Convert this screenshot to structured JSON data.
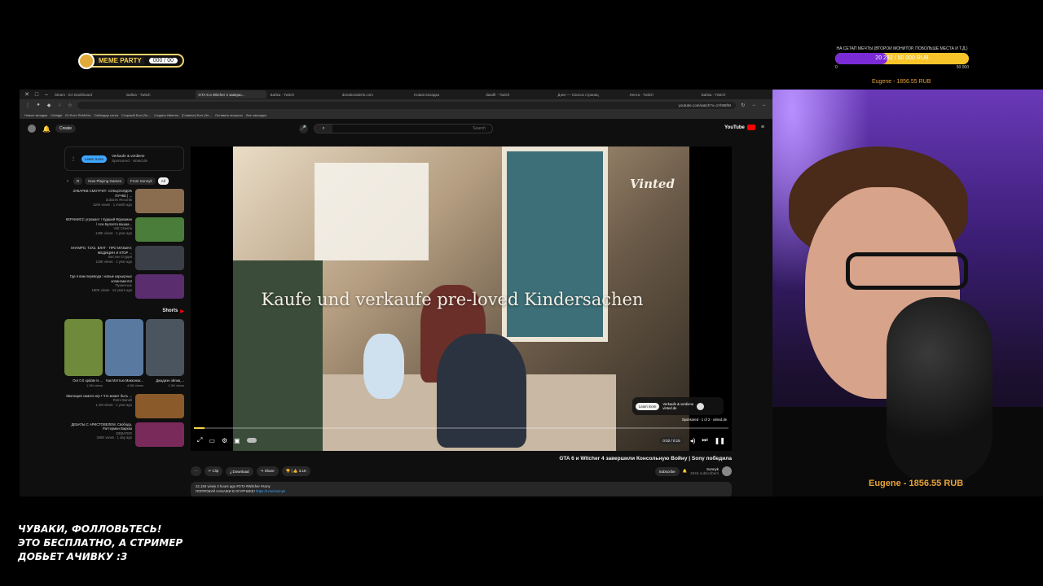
{
  "overlays": {
    "meme_badge": {
      "title": "MEME PARTY",
      "value": "000 / 00"
    },
    "donation_goal": {
      "title": "НА СЕТАП МЕЧТЫ (ВТОРОЙ МОНИТОР, ПОБОЛЬШЕ МЕСТА И Т.Д.)",
      "progress_text": "20 292 / 50 000 RUB",
      "progress_fraction": 0.39,
      "min": "0",
      "max": "50 000",
      "top_donor": "Eugene - 1856.55 RUB"
    },
    "webcam_name": "Eugene - 1856.55 RUB",
    "follow_text": [
      "ЧУВАКИ, ФОЛЛОВЬТЕСЬ!",
      "ЭТО БЕСПЛАТНО, А СТРИМЕР",
      "ДОБЬЕТ АЧИВКУ :3"
    ]
  },
  "browser": {
    "tabs": [
      "Steam - EA Dashboard",
      "Бабка - Twitch",
      "GTA 6 и Witcher 4 заверш...",
      "Бабка - Twitch",
      "donationalerts.com",
      "Новая вкладка",
      "dasdfr - Twitch",
      "Дзен — Список страниц",
      "Лента - Twitch",
      "Бабка - Twitch"
    ],
    "active_tab_index": 2,
    "url": "youtube.com/watch?v=1Yl9t6fW",
    "bookmarks": [
      "Новые вкладки",
      "Chatgpt",
      "Ю.Фото ReMoDa",
      "Озбандар сетка",
      "Старший Бол (Эн...",
      "Создать Ивенты",
      "[Главное] Бол (Эн...",
      "Оставить вопросы",
      "Все закладки"
    ]
  },
  "youtube": {
    "search_placeholder": "Search",
    "logo_text": "YouTube",
    "create_label": "Create",
    "sidebar": {
      "ad": {
        "title": "Verkaufe & verdiene",
        "sub": "Sponsored · vinted.de",
        "cta": "Learn more"
      },
      "chips": [
        "All",
        "From Sonnyk",
        "Now Playing Games",
        "R"
      ],
      "recommendations": [
        {
          "title": "ЗУБАРЕВ СМОТРИТ: СОКЦООЛДОК ПУЧКЕ | ...",
          "channel": "Zubarev Records",
          "stats": "118K views · 1 month ago",
          "color": "#8a6c4e"
        },
        {
          "title": "КЕРАМИСС угрожает ! Худший Фрукшиан / Але Буллета вашаа...",
          "channel": "Volt Cinema",
          "stats": "148K views · 1 year ago",
          "color": "#4a7d3a"
        },
        {
          "title": "SHAMPO, T2X2, ВЛАТ - ПРО МУЗЫКУ, МЕДИЦИН И КТОР ...",
          "channel": "Бестан Студия",
          "stats": "118K views · 1 year ago",
          "color": "#3a3f48"
        },
        {
          "title": "Где я вам перевода ! новые карьерных копингменто!",
          "channel": "Пушечные",
          "stats": "180K views · 12 years ago",
          "color": "#5a2e6e"
        }
      ],
      "shorts_label": "Shorts",
      "shorts": [
        {
          "title": "Our 0.0 update is ...",
          "views": "1.5M views",
          "color": "#6e8a3a"
        },
        {
          "title": "Как Мэттью Макконах...",
          "views": "4.5M views",
          "color": "#5a79a0"
        },
        {
          "title": "Джадиэн эйлиц ...",
          "views": "1.3M views",
          "color": "#4a5560"
        }
      ],
      "more_recommendations": [
        {
          "title": "Эволюция самого игр • Что может быть ...",
          "channel": "Retro Bandit",
          "stats": "1.2M views · 1 year ago",
          "color": "#8a5a2a"
        },
        {
          "title": "ДЕБАТЫ С АРИСТОВЕЛЕМ. Свобода, Раттерман Вархва",
          "channel": "DEBATER",
          "stats": "348K views · 1 day ago",
          "color": "#7a2a5a"
        }
      ]
    },
    "player": {
      "overlay_text": "Kaufe und verkaufe pre-loved Kindersachen",
      "brand": "Vinted",
      "ad_title": "Verkaufe & verdiene",
      "ad_domain": "vinted.de",
      "ad_cta": "Learn more",
      "sponsored": "Sponsored · 1 of 2 · vinted.de",
      "progress_fraction": 0.02,
      "time": "0:02 / 0:15"
    },
    "video": {
      "title": "GTA 6 и Witcher 4 завершили Консольную Войну | Sony победила",
      "channel": "Sonnyk",
      "channel_subs": "204K subscribers",
      "subscribe": "Subscribe",
      "likes": "3.1K",
      "share": "Share",
      "download": "Download",
      "clip": "Clip",
      "description_stats": "22,193 views  3 hours ago  #GTA #Witcher #sony",
      "description_line2": "ПОПРОБУЙ НАКАЖИ В ОГУРЧИКЕ!",
      "description_link": "https://t.me/sonnyk"
    }
  }
}
